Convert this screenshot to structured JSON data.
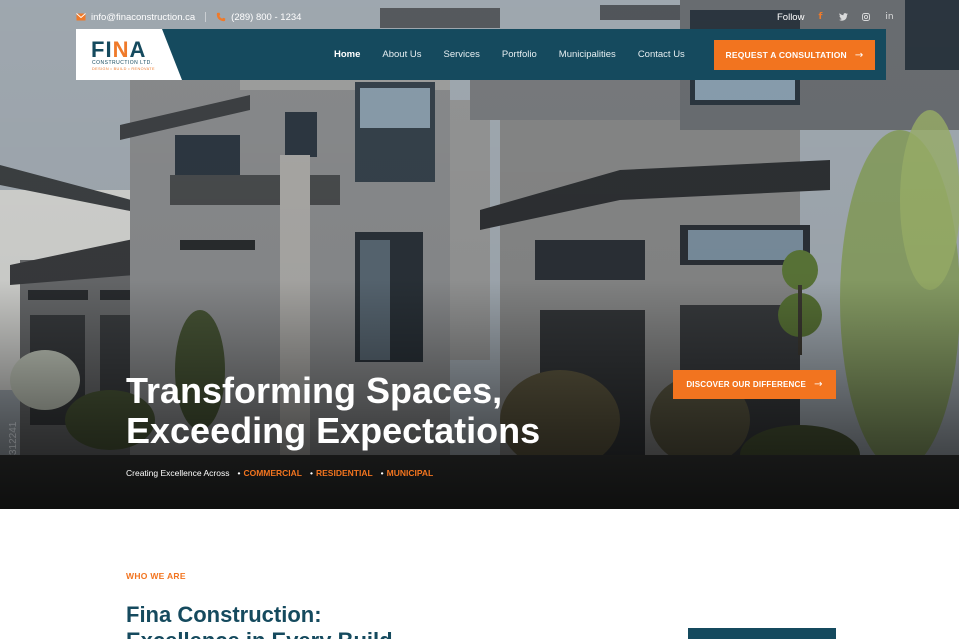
{
  "brand": {
    "logo_text": "FINA",
    "logo_sub": "CONSTRUCTION LTD.",
    "logo_tagline": "DESIGN • BUILD • RENOVATE"
  },
  "topbar": {
    "email": "info@finaconstruction.ca",
    "phone": "(289) 800 - 1234",
    "follow_label": "Follow",
    "social": [
      "f",
      "t",
      "ig",
      "in"
    ]
  },
  "nav": {
    "items": [
      {
        "label": "Home",
        "active": true
      },
      {
        "label": "About Us",
        "active": false
      },
      {
        "label": "Services",
        "active": false
      },
      {
        "label": "Portfolio",
        "active": false
      },
      {
        "label": "Municipalities",
        "active": false
      },
      {
        "label": "Contact Us",
        "active": false
      }
    ],
    "cta_label": "REQUEST A CONSULTATION"
  },
  "hero": {
    "headline_line1": "Transforming Spaces,",
    "headline_line2": "Exceeding Expectations",
    "tagline_prefix": "Creating Excellence Across",
    "tagline_keywords": [
      "COMMERCIAL",
      "RESIDENTIAL",
      "MUNICIPAL"
    ],
    "discover_label": "DISCOVER OUR DIFFERENCE",
    "watermark": "312241"
  },
  "about": {
    "label": "WHO WE ARE",
    "title_line1": "Fina Construction:",
    "title_line2": "Excellence in Every Build"
  },
  "colors": {
    "brand_teal": "#154a5e",
    "accent_orange": "#f2741f"
  }
}
